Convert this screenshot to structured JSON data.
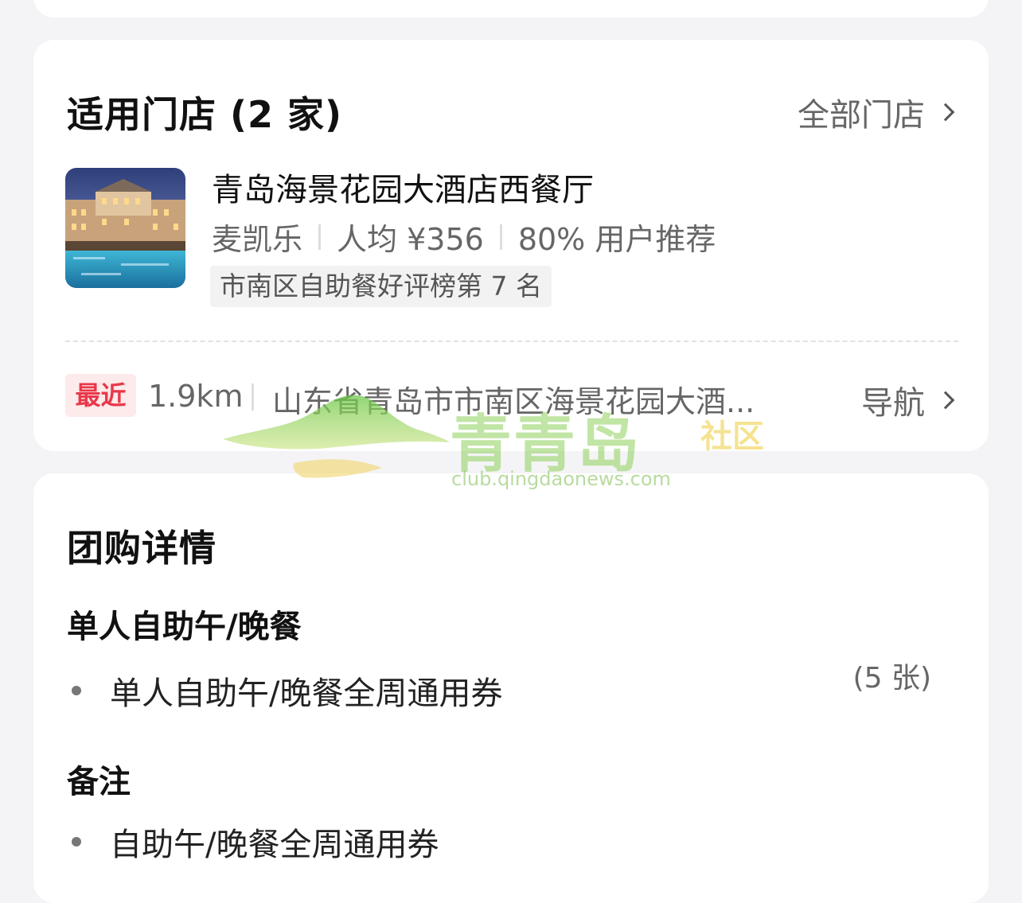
{
  "stores": {
    "title": "适用门店 (2 家)",
    "all_stores_label": "全部门店",
    "store": {
      "name": "青岛海景花园大酒店西餐厅",
      "brand": "麦凯乐",
      "avg_price": "人均 ¥356",
      "recommend": "80% 用户推荐",
      "rank_tag": "市南区自助餐好评榜第 7 名"
    },
    "recent_badge": "最近",
    "distance": "1.9km",
    "address": "山东省青岛市市南区海景花园大酒...",
    "navigate_label": "导航"
  },
  "watermark": {
    "brand_text": "青青岛",
    "community_text": "社区",
    "url": "club.qingdaonews.com"
  },
  "details": {
    "title": "团购详情",
    "group_title": "单人自助午/晚餐",
    "item_name": "单人自助午/晚餐全周通用券",
    "item_qty": "(5 张)",
    "notes_title": "备注",
    "note_text": "自助午/晚餐全周通用券"
  },
  "colors": {
    "page_bg": "#f4f4f6",
    "card_bg": "#ffffff",
    "badge_red": "#e8384a",
    "badge_bg": "#fdeaea",
    "watermark_green": "#8fd15a"
  }
}
